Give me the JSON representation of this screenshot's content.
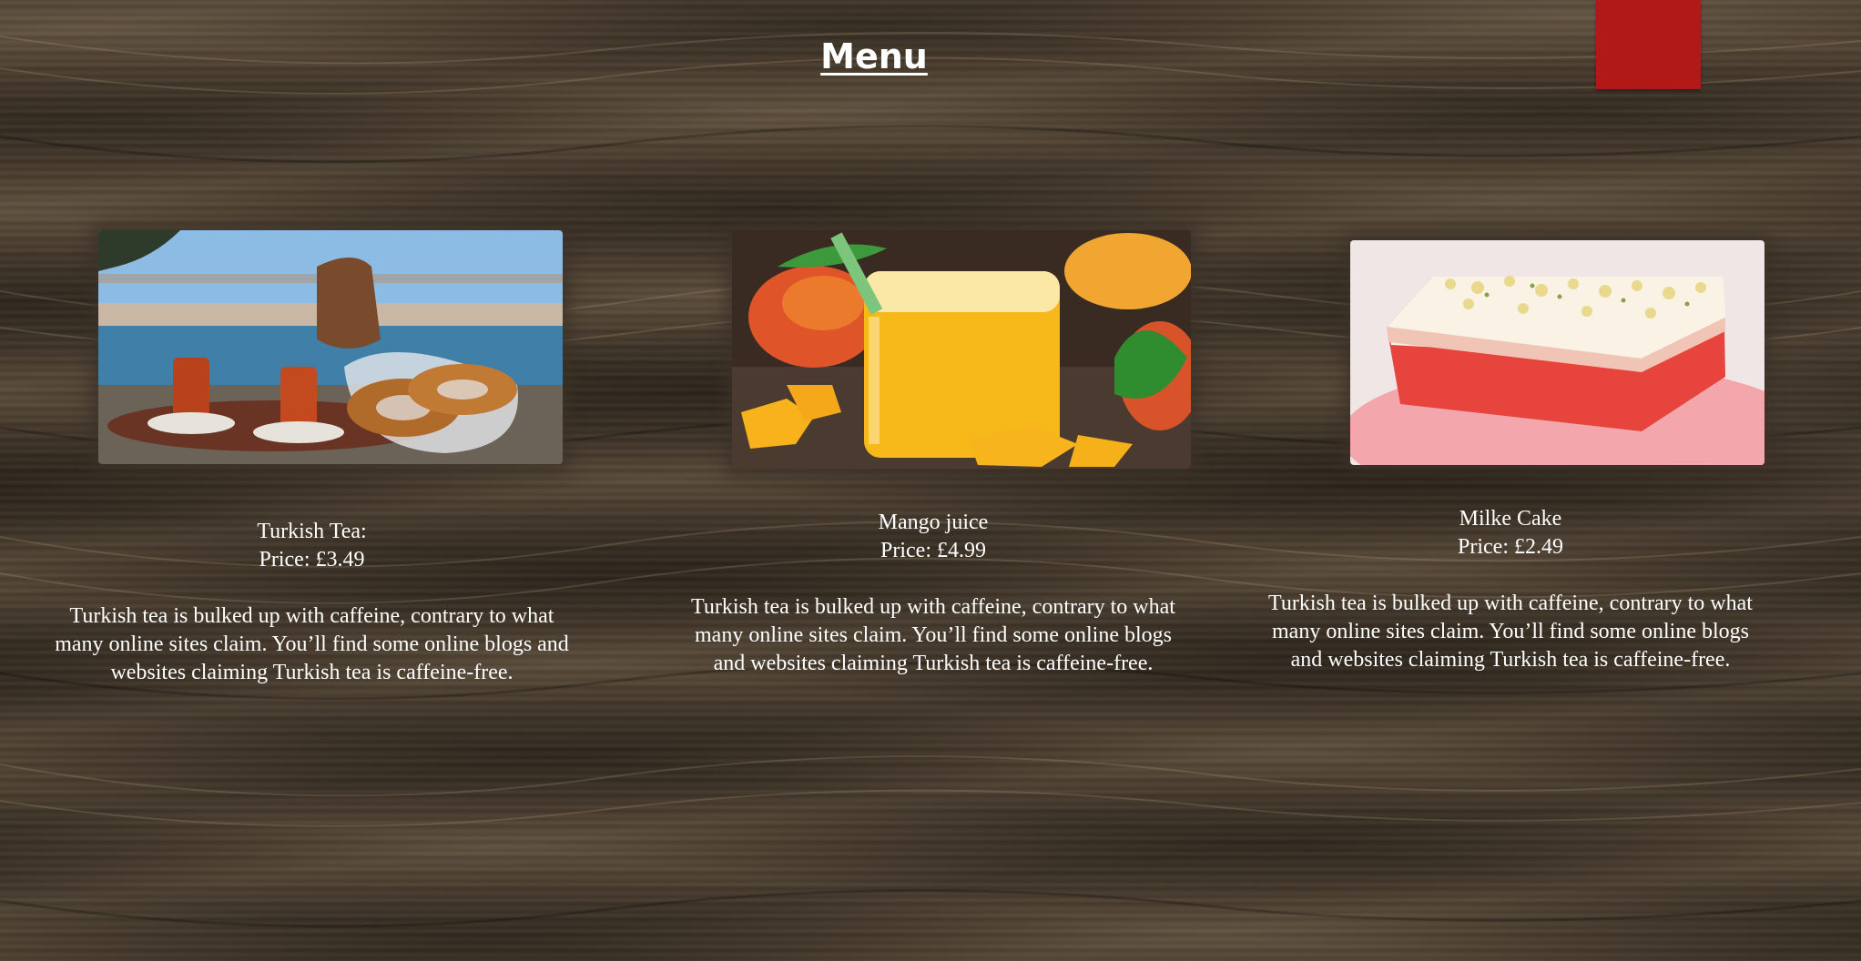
{
  "header": {
    "title": "Menu"
  },
  "menu_items": [
    {
      "name": "Turkish Tea:",
      "price": "Price: £3.49",
      "description": "Turkish tea is bulked up with caffeine, contrary to what many online sites claim. You’ll find some online blogs and websites claiming Turkish tea is caffeine-free."
    },
    {
      "name": "Mango juice",
      "price": "Price: £4.99",
      "description": "Turkish tea is bulked up with caffeine, contrary to what many online sites claim. You’ll find some online blogs and websites claiming Turkish tea is caffeine-free."
    },
    {
      "name": "Milke Cake",
      "price": "Price: £2.49",
      "description": "Turkish tea is bulked up with caffeine, contrary to what many online sites claim. You’ll find some online blogs and websites claiming Turkish tea is caffeine-free."
    }
  ],
  "colors": {
    "accent_box": "#b11918",
    "wood_background": "#3f3427",
    "text": "#ffffff"
  }
}
